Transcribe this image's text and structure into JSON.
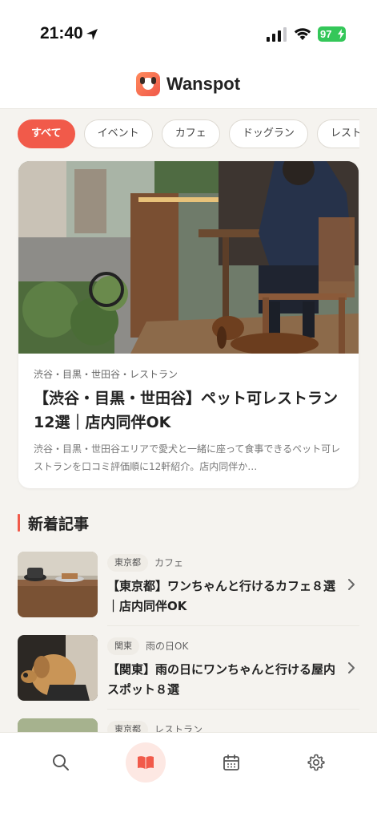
{
  "status_bar": {
    "time": "21:40",
    "battery": "97"
  },
  "header": {
    "app_name": "Wanspot"
  },
  "categories": [
    "すべて",
    "イベント",
    "カフェ",
    "ドッグラン",
    "レストラン"
  ],
  "featured": {
    "meta": "渋谷・目黒・世田谷・レストラン",
    "title": "【渋谷・目黒・世田谷】ペット可レストラン12選｜店内同伴OK",
    "description": "渋谷・目黒・世田谷エリアで愛犬と一緒に座って食事できるペット可レストランを口コミ評価順に12軒紹介。店内同伴か…"
  },
  "section": {
    "title": "新着記事"
  },
  "articles": [
    {
      "region": "東京都",
      "category": "カフェ",
      "title": "【東京都】ワンちゃんと行けるカフェ８選｜店内同伴OK"
    },
    {
      "region": "関東",
      "category": "雨の日OK",
      "title": "【関東】雨の日にワンちゃんと行ける屋内スポット８選"
    },
    {
      "region": "東京都",
      "category": "レストラン",
      "title": ""
    }
  ],
  "nav": {
    "items": [
      "search-icon",
      "book-icon",
      "calendar-icon",
      "gear-icon"
    ]
  },
  "colors": {
    "accent": "#f15a4a",
    "battery": "#34c759"
  }
}
